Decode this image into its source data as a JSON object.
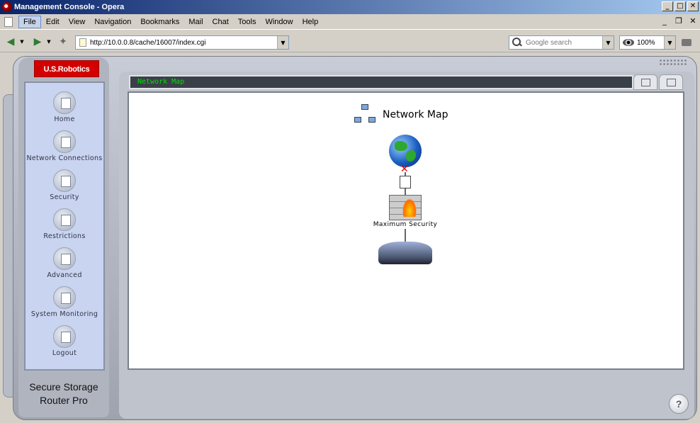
{
  "window": {
    "title": "Management Console - Opera"
  },
  "menubar": {
    "items": [
      "File",
      "Edit",
      "View",
      "Navigation",
      "Bookmarks",
      "Mail",
      "Chat",
      "Tools",
      "Window",
      "Help"
    ]
  },
  "addressbar": {
    "url": "http://10.0.0.8/cache/16007/index.cgi",
    "search_placeholder": "Google search",
    "zoom": "100%"
  },
  "app": {
    "logo": "U.S.Robotics",
    "nav": [
      {
        "label": "Home"
      },
      {
        "label": "Network Connections"
      },
      {
        "label": "Security"
      },
      {
        "label": "Restrictions"
      },
      {
        "label": "Advanced"
      },
      {
        "label": "System Monitoring"
      },
      {
        "label": "Logout"
      }
    ],
    "product": {
      "line1": "Secure Storage",
      "line2": "Router Pro"
    },
    "tab_label": "Network Map",
    "map": {
      "title": "Network Map",
      "firewall_label": "Maximum Security"
    },
    "help": "?"
  }
}
